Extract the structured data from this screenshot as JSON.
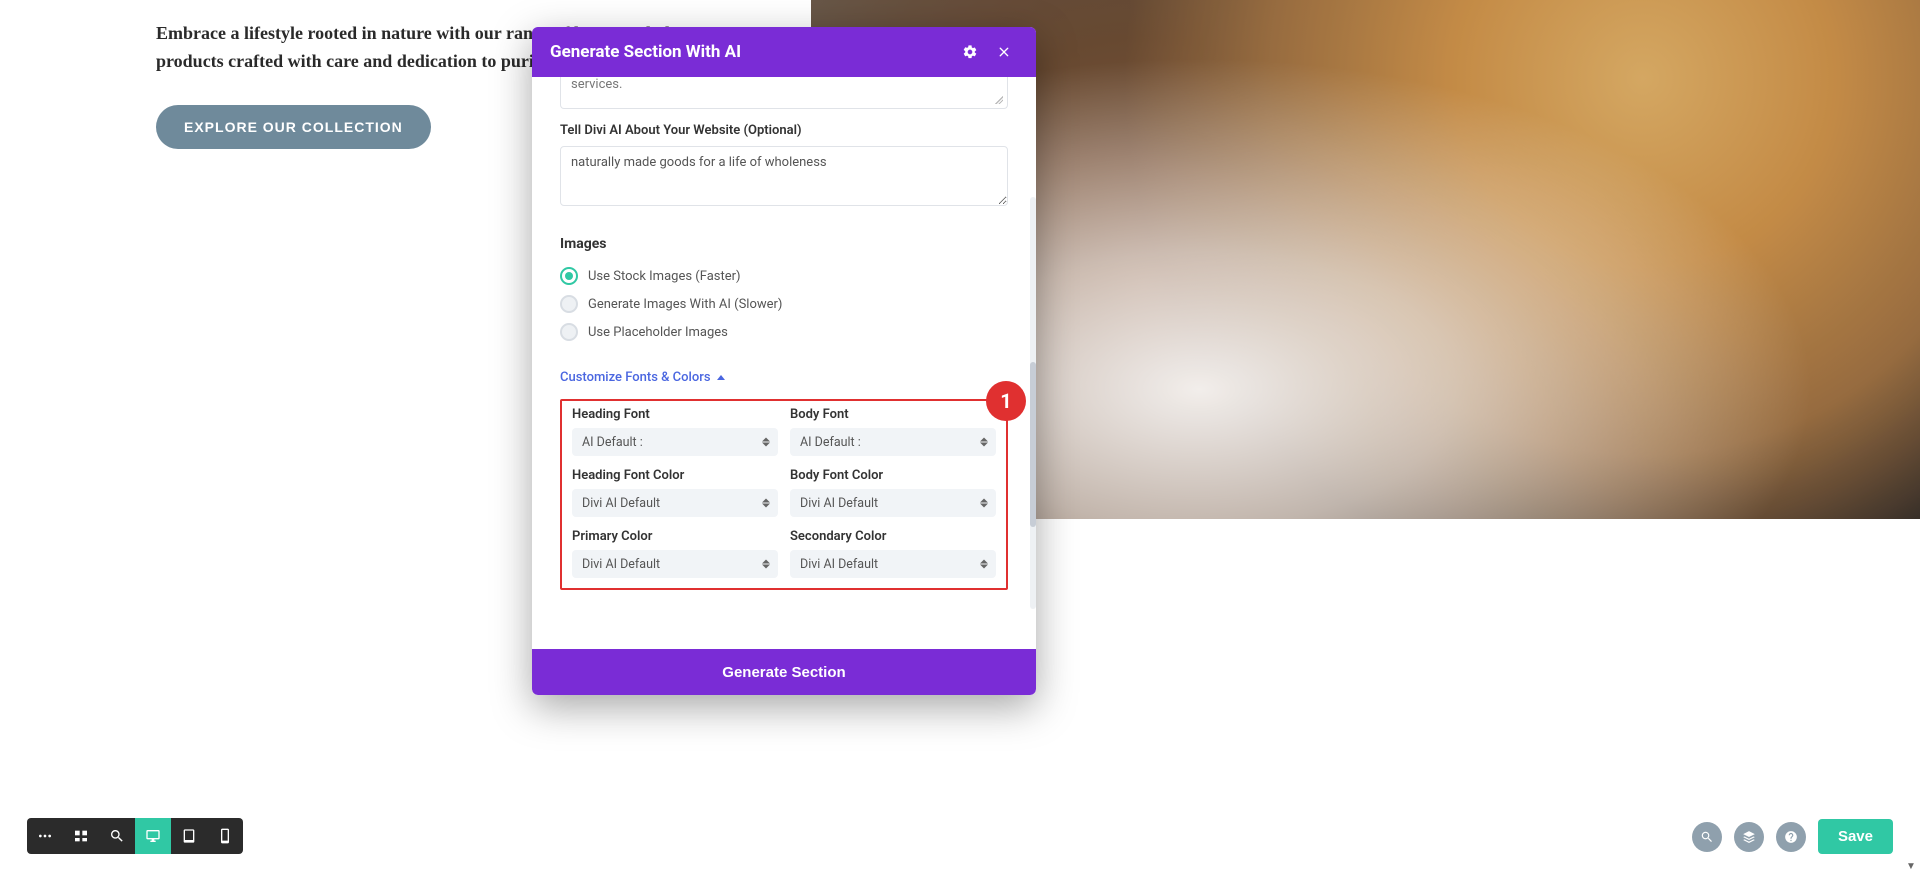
{
  "hero": {
    "text": "Embrace a lifestyle rooted in nature with our range of honest, wholesome products crafted with care and dedication to purity.",
    "explore_label": "EXPLORE OUR COLLECTION"
  },
  "modal": {
    "title": "Generate Section With AI",
    "truncated_textarea_text": "services.",
    "about_label": "Tell Divi AI About Your Website (Optional)",
    "about_value": "naturally made goods for a life of wholeness",
    "images_heading": "Images",
    "radio_stock": "Use Stock Images (Faster)",
    "radio_ai": "Generate Images With AI (Slower)",
    "radio_placeholder": "Use Placeholder Images",
    "customize_link": "Customize Fonts & Colors",
    "fc": {
      "heading_font_label": "Heading Font",
      "heading_font_value": "AI Default :",
      "body_font_label": "Body Font",
      "body_font_value": "AI Default :",
      "heading_color_label": "Heading Font Color",
      "heading_color_value": "Divi AI Default",
      "body_color_label": "Body Font Color",
      "body_color_value": "Divi AI Default",
      "primary_color_label": "Primary Color",
      "primary_color_value": "Divi AI Default",
      "secondary_color_label": "Secondary Color",
      "secondary_color_value": "Divi AI Default"
    },
    "generate_label": "Generate Section"
  },
  "annotation": {
    "badge": "1"
  },
  "bottombar": {
    "save_label": "Save"
  }
}
